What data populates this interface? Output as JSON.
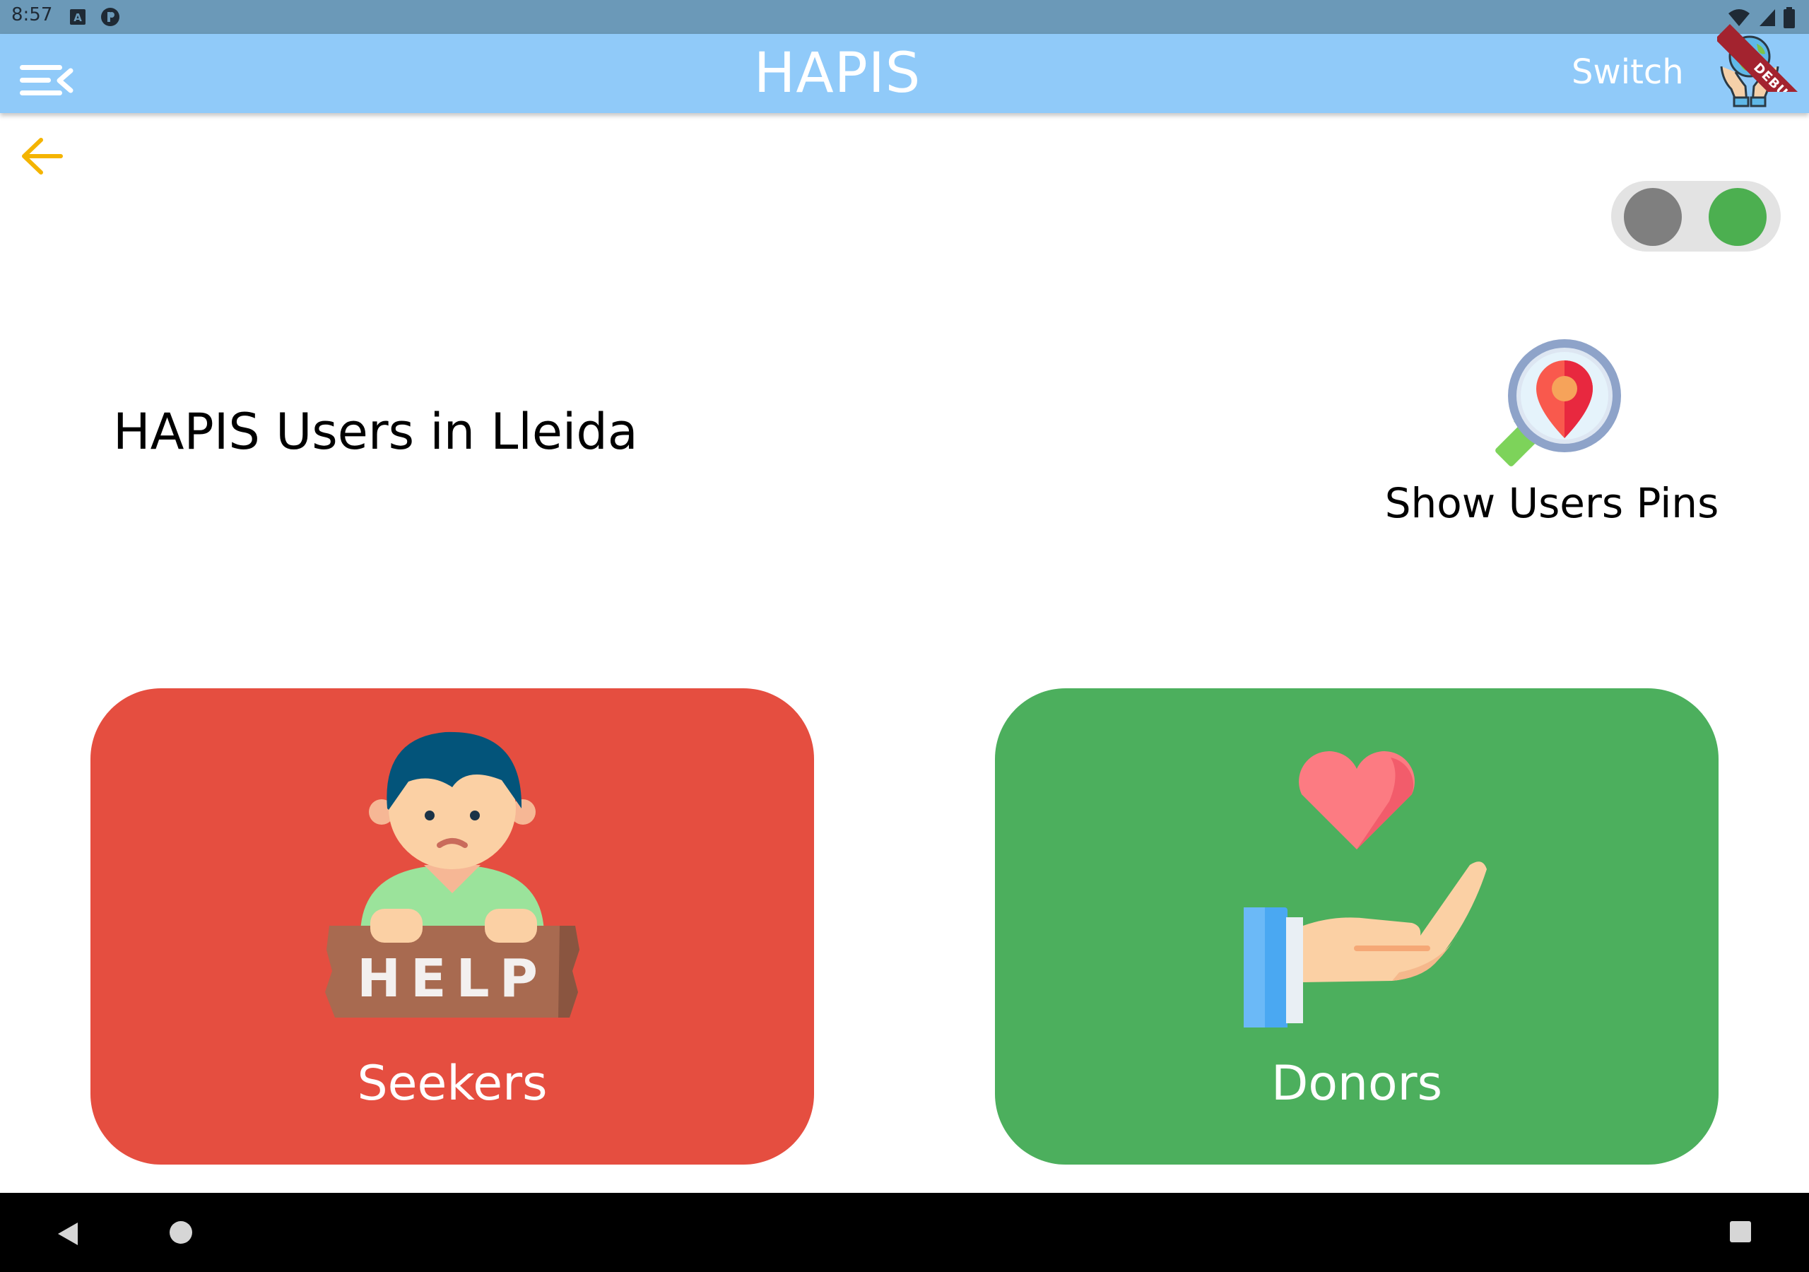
{
  "status_bar": {
    "time": "8:57",
    "icons": [
      "keyboard-a-icon",
      "p-badge-icon",
      "wifi-icon",
      "signal-icon",
      "battery-icon"
    ]
  },
  "app_bar": {
    "menu_icon": "menu-collapse-icon",
    "title": "HAPIS",
    "switch_label": "Switch",
    "logo_icon": "globe-in-hands-icon",
    "debug_label": "DEBUG"
  },
  "page": {
    "back_icon": "arrow-left-icon",
    "toggle_on": true,
    "heading": "HAPIS Users in Lleida",
    "pins_icon": "map-pin-search-icon",
    "pins_label": "Show Users Pins"
  },
  "cards": {
    "seekers_label": "Seekers",
    "seekers_icon_text": "HELP",
    "donors_label": "Donors"
  },
  "colors": {
    "status_bar": "#6b99b8",
    "app_bar": "#90caf9",
    "back_arrow": "#f4b400",
    "seekers": "#e54e40",
    "donors": "#4caf5d",
    "toggle_on": "#4caf50",
    "toggle_off": "#7f7f7f"
  }
}
